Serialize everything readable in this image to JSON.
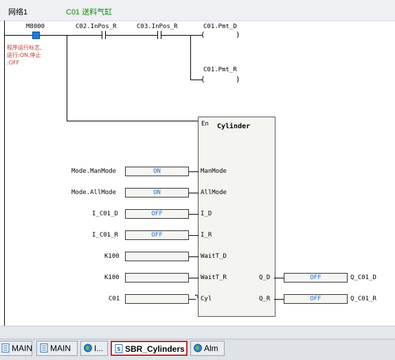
{
  "network": {
    "title": "网络1",
    "comment": "C01 送料气缸"
  },
  "contacts": [
    {
      "label": "M8000"
    },
    {
      "label": "C02.InPos_R"
    },
    {
      "label": "C03.InPos_R"
    }
  ],
  "note": "程序运行标志,\n运行:ON,停止\n:OFF",
  "coils": [
    {
      "label": "C01.Pmt_D"
    },
    {
      "label": "C01.Pmt_R"
    }
  ],
  "function_block": {
    "name": "Cylinder",
    "en": "En",
    "inputs": [
      {
        "pin": "ManMode",
        "source": "Mode.ManMode",
        "value": "ON"
      },
      {
        "pin": "AllMode",
        "source": "Mode.AllMode",
        "value": "ON"
      },
      {
        "pin": "I_D",
        "source": "I_C01_D",
        "value": "OFF"
      },
      {
        "pin": "I_R",
        "source": "I_C01_R",
        "value": "OFF"
      },
      {
        "pin": "WaitT_D",
        "source": "K100",
        "value": ""
      },
      {
        "pin": "WaitT_R",
        "source": "K100",
        "value": ""
      },
      {
        "pin": "Cyl",
        "source": "C01",
        "value": ""
      }
    ],
    "outputs": [
      {
        "pin": "Q_D",
        "target": "Q_C01_D",
        "value": "OFF"
      },
      {
        "pin": "Q_R",
        "target": "Q_C01_R",
        "value": "OFF"
      }
    ]
  },
  "tabs": [
    {
      "label": "MAIN",
      "icon": "document-icon",
      "active": false
    },
    {
      "label": "MAIN",
      "icon": "document-icon",
      "active": false
    },
    {
      "label": "I...",
      "icon": "globe-icon",
      "active": false
    },
    {
      "label": "SBR_Cylinders",
      "icon": "subroutine-icon",
      "active": true
    },
    {
      "label": "Alm",
      "icon": "globe-icon",
      "active": false
    }
  ]
}
